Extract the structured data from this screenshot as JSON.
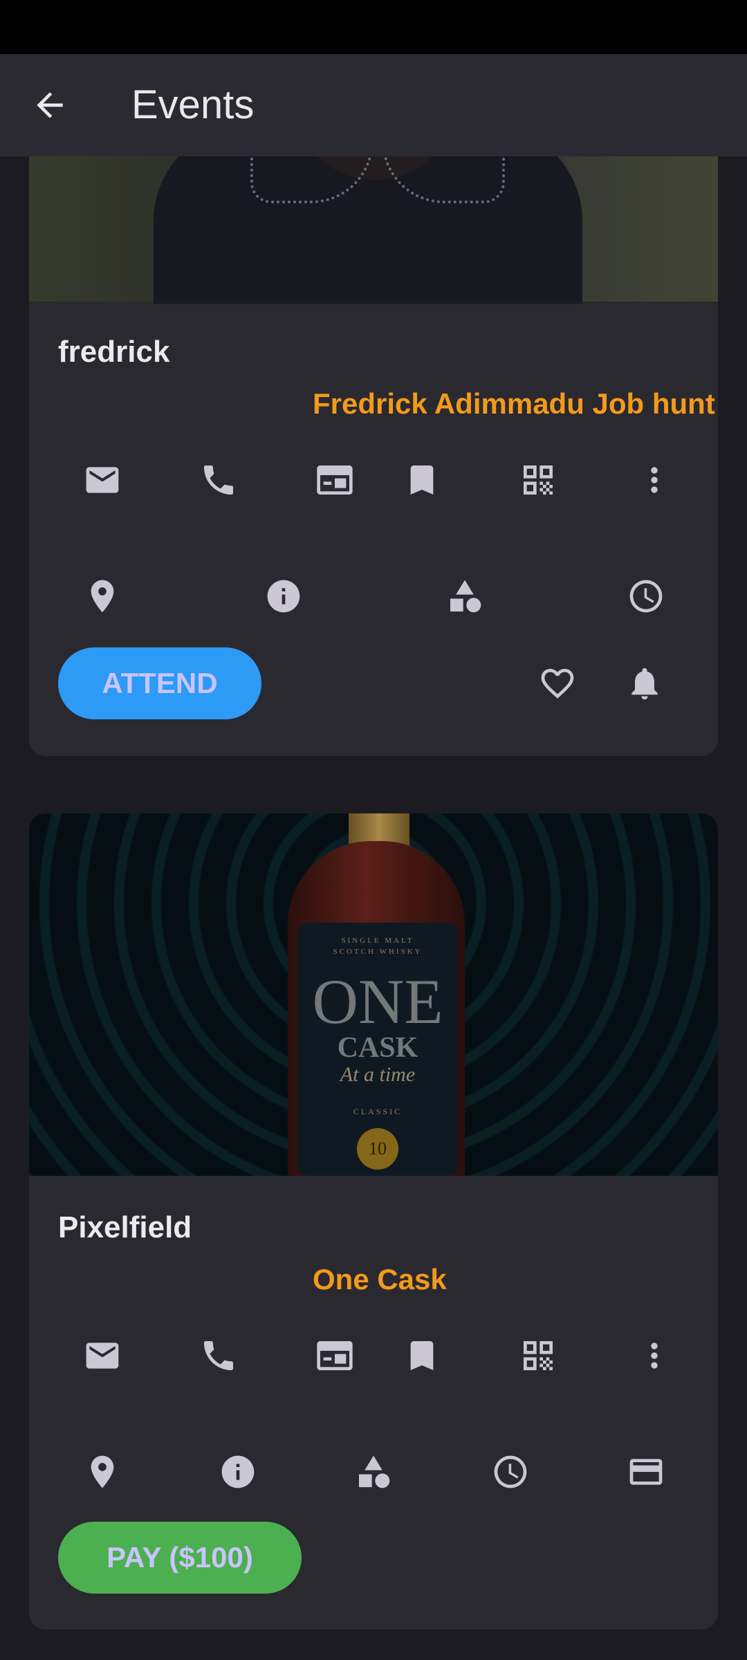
{
  "app_bar": {
    "title": "Events",
    "back_icon": "arrow-back-icon"
  },
  "events": [
    {
      "name": "fredrick",
      "subtitle": "Fredrick Adimmadu Job hunt",
      "primary_button": "ATTEND",
      "primary_color": "#2d9af6",
      "icons_row1": [
        "email-icon",
        "phone-icon",
        "card-view-icon",
        "bookmark-icon",
        "qr-code-icon",
        "more-vert-icon"
      ],
      "icons_row2": [
        "location-icon",
        "info-icon",
        "category-icon",
        "clock-icon"
      ],
      "icons_row3": [
        "heart-icon",
        "bell-icon"
      ]
    },
    {
      "name": "Pixelfield",
      "subtitle": "One Cask",
      "primary_button": "PAY ($100)",
      "primary_color": "#4caf50",
      "icons_row1": [
        "email-icon",
        "phone-icon",
        "card-view-icon",
        "bookmark-icon",
        "qr-code-icon",
        "more-vert-icon"
      ],
      "icons_row2": [
        "location-icon",
        "info-icon",
        "category-icon",
        "clock-icon",
        "credit-card-icon"
      ],
      "image_label": {
        "line1": "SINGLE MALT",
        "line2": "SCOTCH WHISKY",
        "brand1": "ONE",
        "brand2": "CASK",
        "tagline": "At a time",
        "classic": "CLASSIC",
        "badge": "10"
      }
    }
  ],
  "colors": {
    "accent_orange": "#f39a1b",
    "background": "#1c1b21",
    "card": "#2a2930",
    "app_bar": "#2b2a33"
  }
}
